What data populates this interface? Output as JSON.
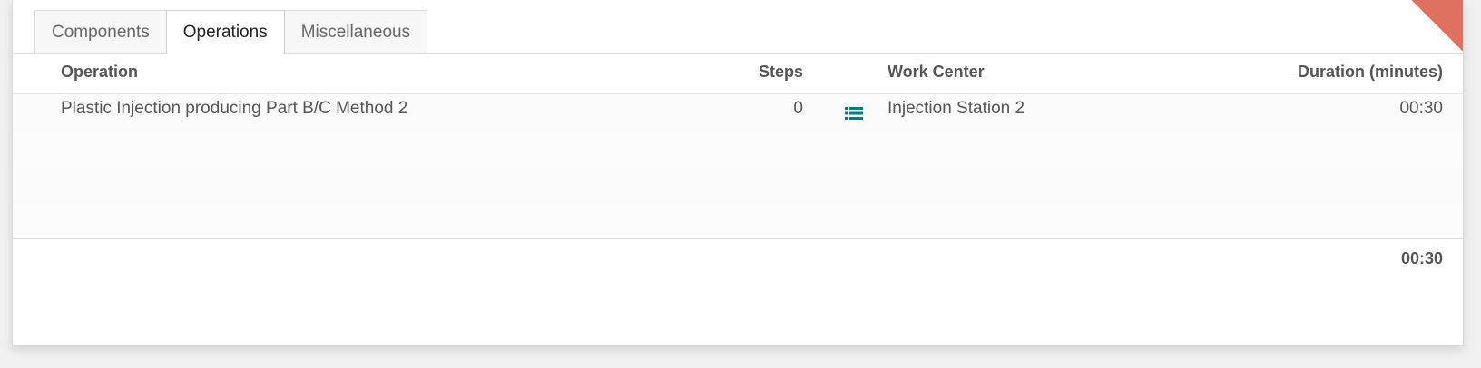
{
  "tabs": [
    {
      "label": "Components",
      "active": false
    },
    {
      "label": "Operations",
      "active": true
    },
    {
      "label": "Miscellaneous",
      "active": false
    }
  ],
  "table": {
    "columns": {
      "operation": "Operation",
      "steps": "Steps",
      "work_center": "Work Center",
      "duration": "Duration (minutes)"
    },
    "rows": [
      {
        "operation": "Plastic Injection producing Part B/C Method 2",
        "steps": "0",
        "steps_icon": "list-icon",
        "work_center": "Injection Station 2",
        "duration": "00:30"
      }
    ],
    "footer": {
      "duration_total": "00:30"
    }
  },
  "colors": {
    "accent": "#017e84",
    "ribbon": "#e0705f"
  }
}
